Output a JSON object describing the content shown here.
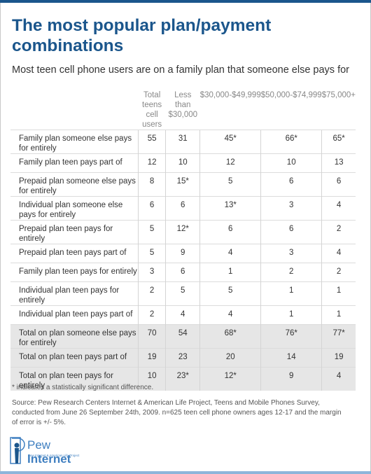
{
  "title": "The most popular plan/payment combinations",
  "subtitle": "Most teen cell phone users are on a family plan that someone else pays for",
  "colors": {
    "brand": "#1b568c",
    "accent_bar": "#8db5da",
    "total_row_bg": "#e6e6e6"
  },
  "table": {
    "headers": [
      "",
      "Total teens cell users",
      "Less than $30,000",
      "$30,000-$49,999",
      "$50,000-$74,999",
      "$75,000+"
    ],
    "rows": [
      {
        "label": "Family plan someone else pays for entirely",
        "values": [
          "55",
          "31",
          "45*",
          "66*",
          "65*"
        ]
      },
      {
        "label": "Family plan teen pays part of",
        "values": [
          "12",
          "10",
          "12",
          "10",
          "13"
        ]
      },
      {
        "label": "Prepaid plan someone else pays for entirely",
        "values": [
          "8",
          "15*",
          "5",
          "6",
          "6"
        ]
      },
      {
        "label": "Individual plan someone else pays for entirely",
        "values": [
          "6",
          "6",
          "13*",
          "3",
          "4"
        ]
      },
      {
        "label": "Prepaid plan teen pays for entirely",
        "values": [
          "5",
          "12*",
          "6",
          "6",
          "2"
        ]
      },
      {
        "label": "Prepaid plan teen pays part of",
        "values": [
          "5",
          "9",
          "4",
          "3",
          "4"
        ]
      },
      {
        "label": "Family plan teen pays for entirely",
        "values": [
          "3",
          "6",
          "1",
          "2",
          "2"
        ]
      },
      {
        "label": "Individual plan teen pays for entirely",
        "values": [
          "2",
          "5",
          "5",
          "1",
          "1"
        ]
      },
      {
        "label": "Individual plan teen pays part of",
        "values": [
          "2",
          "4",
          "4",
          "1",
          "1"
        ]
      },
      {
        "label": "Total on plan someone else pays for entirely",
        "values": [
          "70",
          "54",
          "68*",
          "76*",
          "77*"
        ],
        "total": true
      },
      {
        "label": "Total on plan teen pays part of",
        "values": [
          "19",
          "23",
          "20",
          "14",
          "19"
        ],
        "total": true
      },
      {
        "label": "Total on plan teen pays for entirely",
        "values": [
          "10",
          "23*",
          "12*",
          "9",
          "4"
        ],
        "total": true
      }
    ]
  },
  "footnote": "* indicates a statistically significant difference.",
  "source": "Source: Pew Research Centers Internet & American Life Project, Teens and Mobile Phones Survey, conducted from June 26  September 24th, 2009. n=625 teen cell phone owners ages 12-17 and the margin of error is +/- 5%.",
  "logo": {
    "word1": "Pew",
    "word2": "Internet",
    "tagline": "Pew Internet & American Life Project"
  }
}
